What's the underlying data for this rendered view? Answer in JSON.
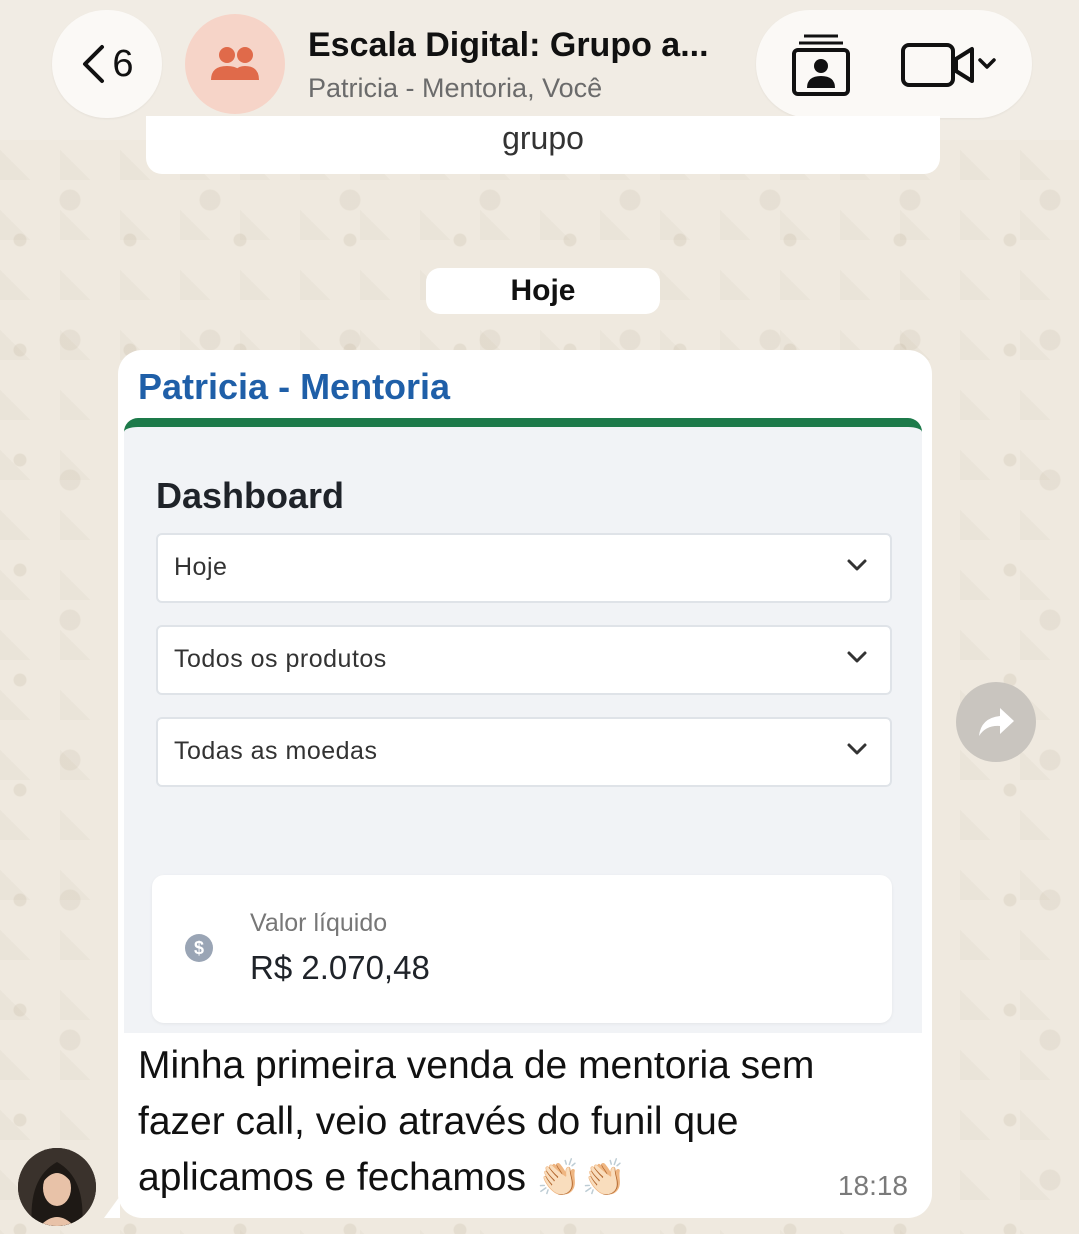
{
  "header": {
    "back_count": "6",
    "title": "Escala Digital: Grupo a...",
    "subtitle": "Patricia - Mentoria, Você",
    "icons": {
      "back": "chevron-left-icon",
      "group": "group-icon",
      "contact": "contact-card-icon",
      "video": "video-call-icon"
    }
  },
  "previous_message": {
    "text": "grupo"
  },
  "date_separator": "Hoje",
  "message": {
    "sender": "Patricia - Mentoria",
    "sender_color": "#1f5fa8",
    "screenshot": {
      "title": "Dashboard",
      "accent": "#1d7a4a",
      "dropdowns": [
        {
          "label": "Hoje"
        },
        {
          "label": "Todos os produtos"
        },
        {
          "label": "Todas as moedas"
        }
      ],
      "card": {
        "label": "Valor líquido",
        "value": "R$ 2.070,48",
        "icon": "dollar-icon"
      }
    },
    "text": "Minha primeira venda de mentoria sem fazer call, veio através do funil que aplicamos e fechamos",
    "emoji": "👏🏻👏🏻",
    "time": "18:18"
  },
  "forward_icon": "forward-icon"
}
